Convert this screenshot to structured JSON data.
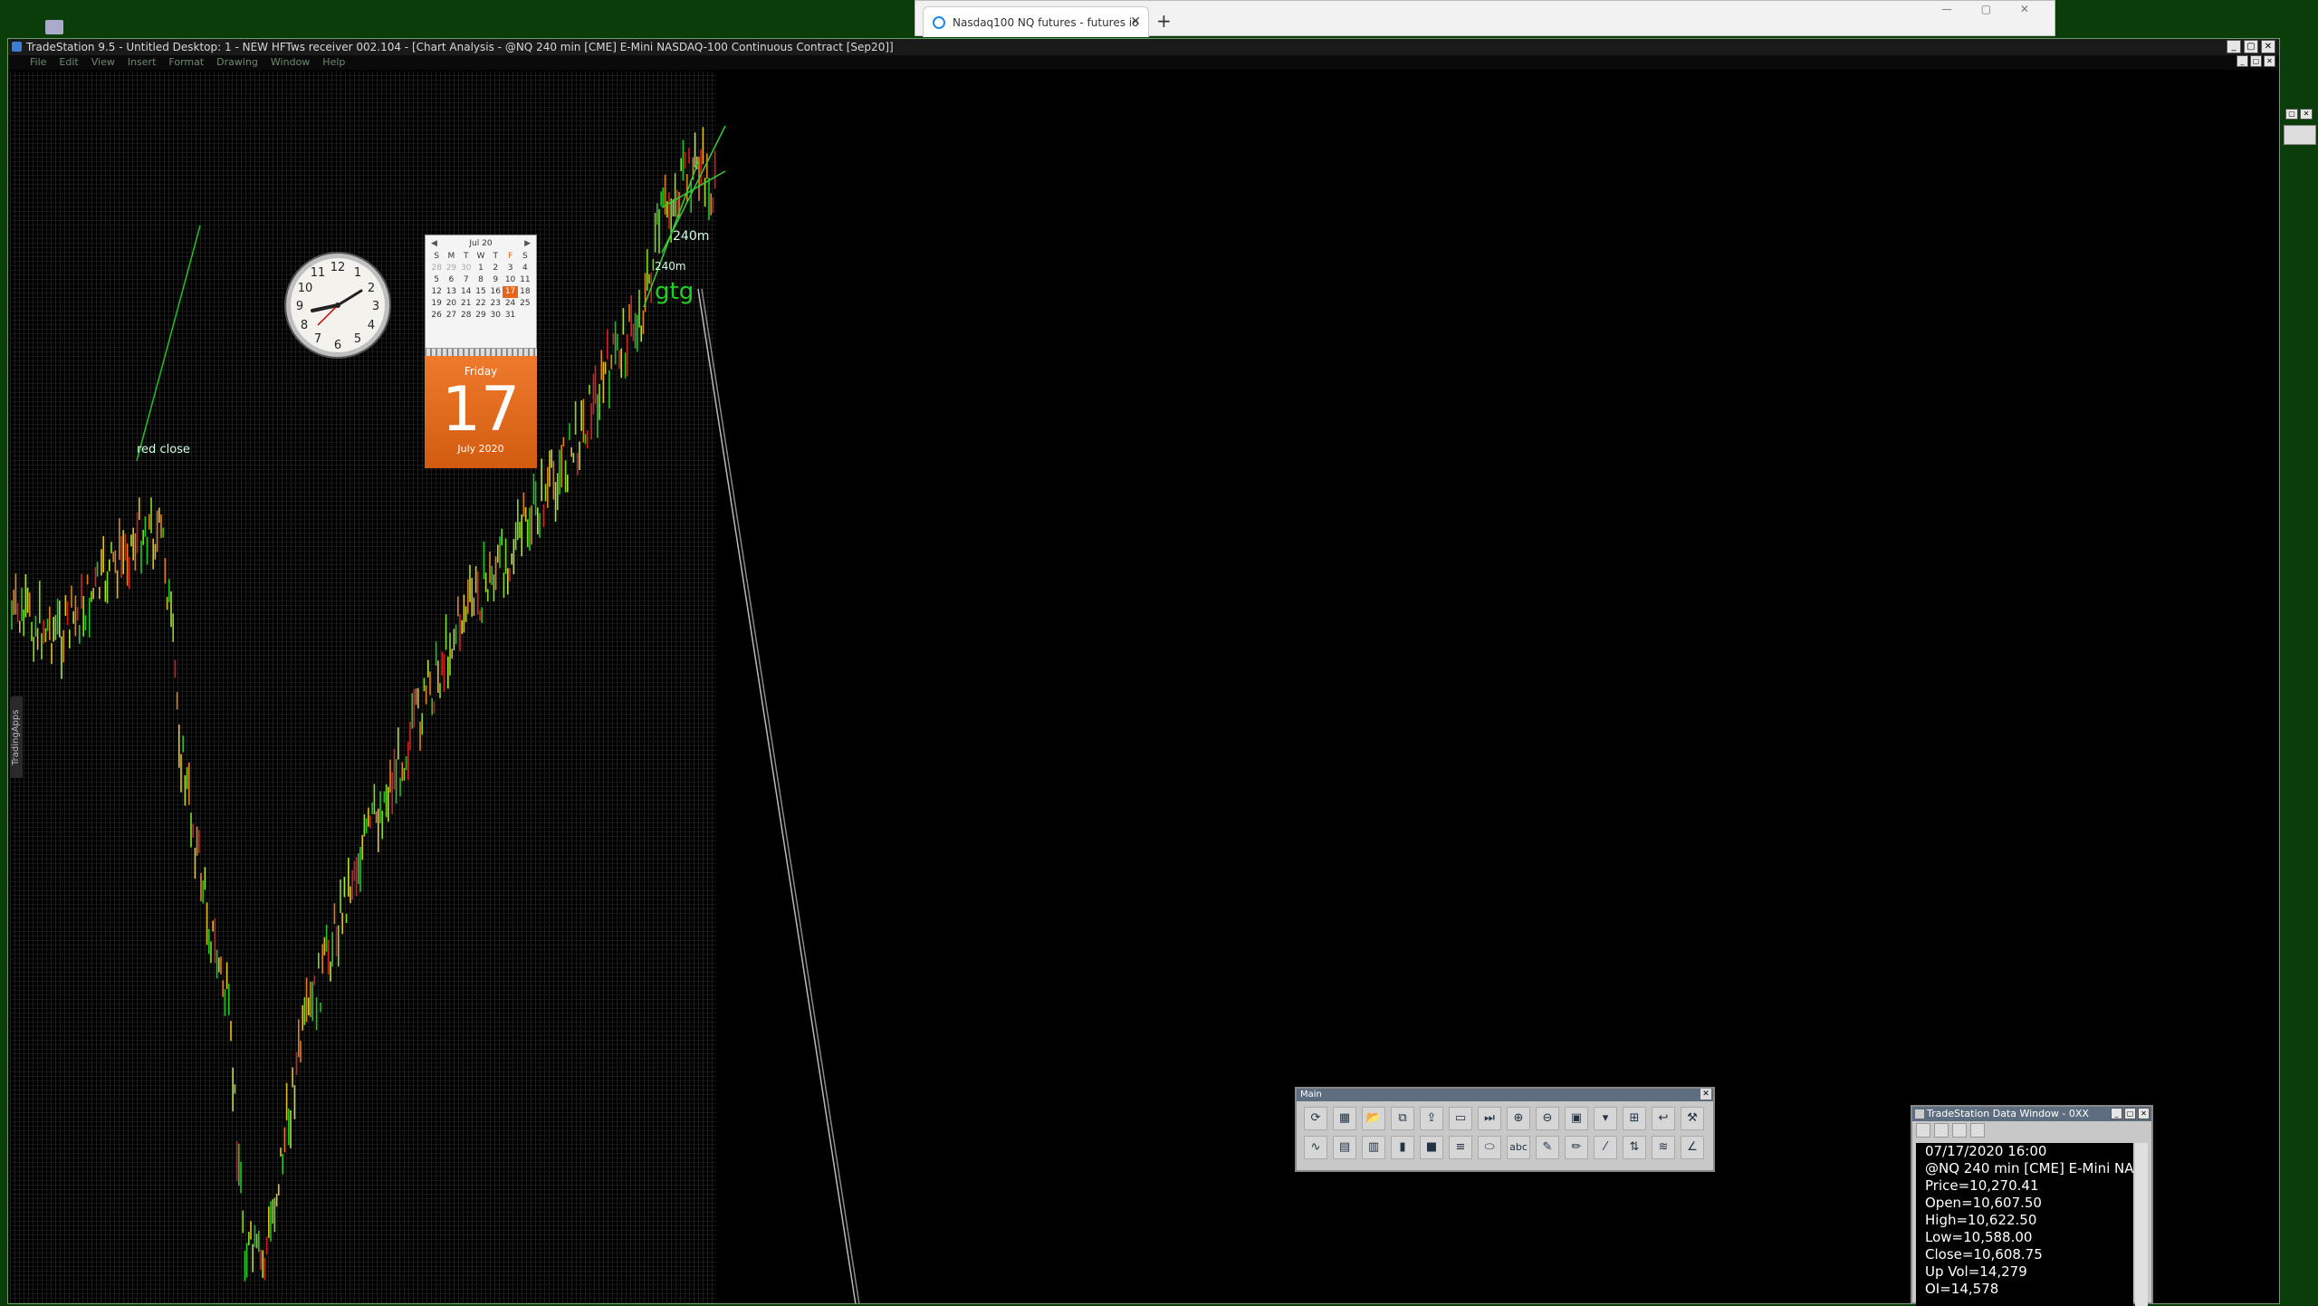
{
  "browser": {
    "tab_title": "Nasdaq100 NQ futures - futures io",
    "new_tab": "+",
    "close": "✕"
  },
  "ts_window": {
    "title": "TradeStation 9.5 - Untitled Desktop: 1 - NEW HFTws receiver 002.104 - [Chart Analysis - @NQ 240 min [CME] E-Mini NASDAQ-100 Continuous Contract [Sep20]]",
    "menu": [
      "File",
      "Edit",
      "View",
      "Insert",
      "Format",
      "Drawing",
      "Window",
      "Help"
    ]
  },
  "chart": {
    "side_tab": "TradingApps",
    "labels": {
      "red_close": "red close",
      "m240_a": "240m",
      "m240_b": "240m",
      "gtg": "gtg"
    }
  },
  "calendar": {
    "month_label": "Jul 20",
    "weekdays": [
      "S",
      "M",
      "T",
      "W",
      "T",
      "F",
      "S"
    ],
    "days": [
      "28",
      "29",
      "30",
      "1",
      "2",
      "3",
      "4",
      "5",
      "6",
      "7",
      "8",
      "9",
      "10",
      "11",
      "12",
      "13",
      "14",
      "15",
      "16",
      "17",
      "18",
      "19",
      "20",
      "21",
      "22",
      "23",
      "24",
      "25",
      "26",
      "27",
      "28",
      "29",
      "30",
      "31",
      ""
    ],
    "day_of_week": "Friday",
    "day_number": "17",
    "month_year": "July 2020"
  },
  "toolbar": {
    "title": "Main",
    "row1_icons": [
      "refresh-icon",
      "grid-icon",
      "open-folder-icon",
      "copy-icon",
      "export-icon",
      "page-icon",
      "jump-end-icon",
      "zoom-in-icon",
      "zoom-out-icon",
      "monitor-icon",
      "dropdown-icon",
      "add-table-icon",
      "curve-icon",
      "tools-icon"
    ],
    "row2_icons": [
      "indicator-icon",
      "strategy-icon",
      "workspace-icon",
      "colorbar-icon",
      "dark-icon",
      "lines-icon",
      "oval-icon",
      "abc-text-icon",
      "highlighter-icon",
      "pencil-icon",
      "trendline-icon",
      "fib-icon",
      "wave-icon",
      "angle-icon"
    ],
    "abc_label": "abc"
  },
  "data_window": {
    "title": "TradeStation Data Window - 0XX",
    "lines": [
      "07/17/2020 16:00",
      "@NQ 240 min [CME] E-Mini NA",
      "Price=10,270.41",
      "Open=10,607.50",
      "High=10,622.50",
      "Low=10,588.00",
      "Close=10,608.75",
      "Up Vol=14,279",
      "OI=14,578"
    ]
  }
}
